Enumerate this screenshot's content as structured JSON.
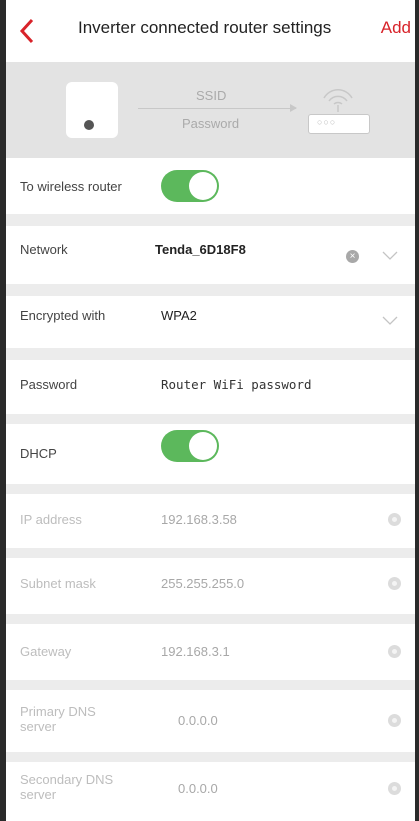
{
  "header": {
    "back_icon": "chevron-left-icon",
    "title": "Inverter connected router settings",
    "add_label": "Add",
    "accent_color": "#d8232a"
  },
  "banner": {
    "ssid_label": "SSID",
    "password_label": "Password"
  },
  "settings": {
    "wireless_router": {
      "label": "To wireless router",
      "enabled": true
    },
    "network": {
      "label": "Network",
      "value": "Tenda_6D18F8"
    },
    "encryption": {
      "label": "Encrypted with",
      "value": "WPA2"
    },
    "password": {
      "label": "Password",
      "placeholder": "Router WiFi password"
    },
    "dhcp": {
      "label": "DHCP",
      "enabled": true
    },
    "ip_address": {
      "label": "IP address",
      "value": "192.168.3.58"
    },
    "subnet_mask": {
      "label": "Subnet mask",
      "value": "255.255.255.0"
    },
    "gateway": {
      "label": "Gateway",
      "value": "192.168.3.1"
    },
    "primary_dns": {
      "label_line1": "Primary DNS",
      "label_line2": "server",
      "value": "0.0.0.0"
    },
    "secondary_dns": {
      "label_line1": "Secondary DNS",
      "label_line2": "server",
      "value": "0.0.0.0"
    }
  },
  "colors": {
    "toggle_on": "#5cb85c",
    "banner_bg": "#e3e3e3",
    "separator": "#ececec"
  }
}
